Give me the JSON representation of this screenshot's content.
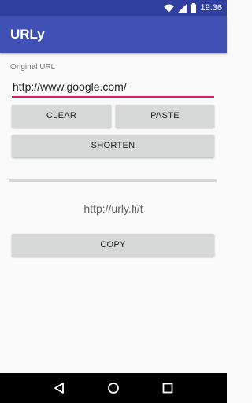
{
  "status_bar": {
    "time": "19:36",
    "icons": [
      "wifi-icon",
      "signal-icon",
      "battery-icon"
    ]
  },
  "app_bar": {
    "title": "URLy"
  },
  "form": {
    "field_label": "Original URL",
    "url_value": "http://www.google.com/",
    "clear_label": "CLEAR",
    "paste_label": "PASTE",
    "shorten_label": "SHORTEN"
  },
  "result": {
    "short_url": "http://urly.fi/t",
    "copy_label": "COPY"
  },
  "nav_bar": {
    "icons": [
      "back-icon",
      "home-icon",
      "recents-icon"
    ]
  },
  "colors": {
    "primary": "#3f51b5",
    "primary_dark": "#303f9f",
    "accent": "#e91e63",
    "button": "#d6d7d7"
  }
}
